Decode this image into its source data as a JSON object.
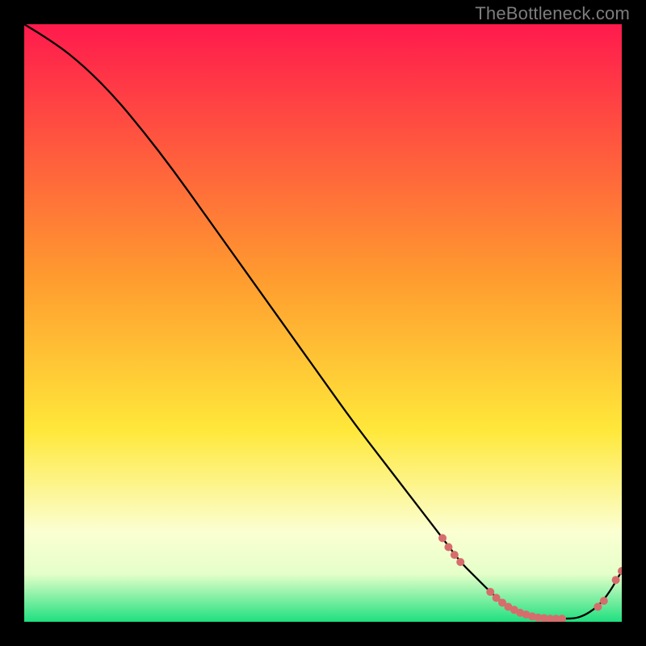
{
  "watermark": "TheBottleneck.com",
  "colors": {
    "bg": "#000000",
    "grad_top": "#ff1a4d",
    "grad_mid1": "#ff9730",
    "grad_mid2": "#ffe838",
    "grad_low": "#faffd9",
    "grad_band_top": "#e6ffd0",
    "grad_band_bot": "#1fe07f",
    "stroke": "#000000",
    "dot": "#d66d6d"
  },
  "chart_data": {
    "type": "line",
    "title": "",
    "xlabel": "",
    "ylabel": "",
    "x": [
      0,
      5,
      10,
      15,
      20,
      25,
      30,
      35,
      40,
      45,
      50,
      55,
      60,
      65,
      70,
      73,
      75,
      78,
      80,
      82,
      84,
      86,
      88,
      90,
      93,
      96,
      98,
      100
    ],
    "y": [
      100,
      97,
      93,
      88,
      82,
      75.5,
      68.5,
      61.5,
      54.5,
      47.5,
      40.5,
      33.5,
      27,
      20.5,
      14,
      10,
      8,
      5,
      3.2,
      2,
      1.2,
      0.7,
      0.5,
      0.5,
      0.6,
      2.5,
      5,
      8.5
    ],
    "xlim": [
      0,
      100
    ],
    "ylim": [
      0,
      100
    ],
    "highlight_points": {
      "x": [
        70,
        71,
        72,
        73,
        78,
        79,
        80,
        81,
        82,
        83,
        84,
        85,
        86,
        87,
        88,
        89,
        90,
        96,
        97,
        99,
        100
      ],
      "y": [
        14,
        12.5,
        11.2,
        10,
        5,
        4,
        3.2,
        2.5,
        2,
        1.5,
        1.2,
        0.9,
        0.7,
        0.6,
        0.5,
        0.5,
        0.5,
        2.5,
        3.5,
        7,
        8.5
      ]
    },
    "gradient_stops": [
      {
        "pct": 0,
        "color": "#ff1a4d"
      },
      {
        "pct": 42,
        "color": "#ff9a2f"
      },
      {
        "pct": 68,
        "color": "#ffe83a"
      },
      {
        "pct": 85,
        "color": "#fbffd2"
      },
      {
        "pct": 92,
        "color": "#e5ffc9"
      },
      {
        "pct": 100,
        "color": "#1fe07f"
      }
    ]
  }
}
